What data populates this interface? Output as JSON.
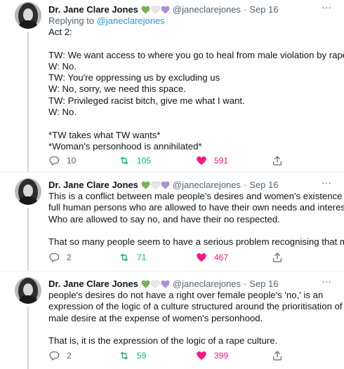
{
  "tweets": [
    {
      "name": "Dr. Jane Clare Jones",
      "handle": "@janeclarejones",
      "date": "Sep 16",
      "sep": "·",
      "more": "···",
      "replying_prefix": "Replying to ",
      "replying_handle": "@janeclarejones",
      "lines": [
        "Act 2:",
        "",
        "TW: We want access to where you go to heal from male violation by rape",
        "W: No.",
        "TW: You're oppressing us by excluding us",
        "W: No, sorry, we need this space.",
        "TW: Privileged racist bitch, give me what I want.",
        "W: No.",
        "",
        "*TW takes what TW wants*",
        "*Woman's personhood is annihilated*"
      ],
      "replies": "10",
      "retweets": "105",
      "likes": "591"
    },
    {
      "name": "Dr. Jane Clare Jones",
      "handle": "@janeclarejones",
      "date": "Sep 16",
      "sep": "·",
      "more": "···",
      "lines": [
        "This is a conflict between male people's desires and women's existence as",
        "full human persons who are allowed to have their own needs and interests.",
        "Who are allowed to say no, and have their no respected.",
        "",
        "That so many people seem to have a serious problem recognising that male"
      ],
      "replies": "2",
      "retweets": "71",
      "likes": "467"
    },
    {
      "name": "Dr. Jane Clare Jones",
      "handle": "@janeclarejones",
      "date": "Sep 16",
      "sep": "·",
      "more": "···",
      "lines": [
        "people's desires do not have a right over female people's 'no,' is an",
        "expression of the logic of a culture structured around the prioritisation of",
        "male desire at the expense of women's personhood.",
        "",
        "That is, it is the expression of the logic of a rape culture."
      ],
      "replies": "2",
      "retweets": "59",
      "likes": "399"
    }
  ],
  "colors": {
    "heart_green": "#78b159",
    "heart_white": "#e7e7e7",
    "heart_purple": "#aa8ed6",
    "retweet": "#00ba7c",
    "like": "#f91880",
    "link": "#1d9bf0",
    "muted": "#536471"
  },
  "icons": [
    "reply-icon",
    "retweet-icon",
    "like-icon",
    "share-icon",
    "more-icon",
    "heart-emoji-icon"
  ]
}
